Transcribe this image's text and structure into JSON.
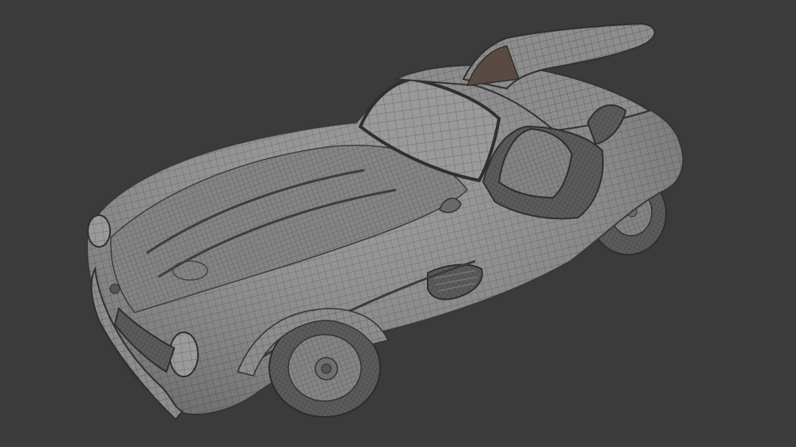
{
  "viewport": {
    "background": "#3b3b3b"
  },
  "model": {
    "subject": "wireframe-sports-car",
    "shading": "clay-with-wireframe",
    "surface_color": "#8e8e8e",
    "wire_color": "#444444",
    "doors_open": true
  }
}
